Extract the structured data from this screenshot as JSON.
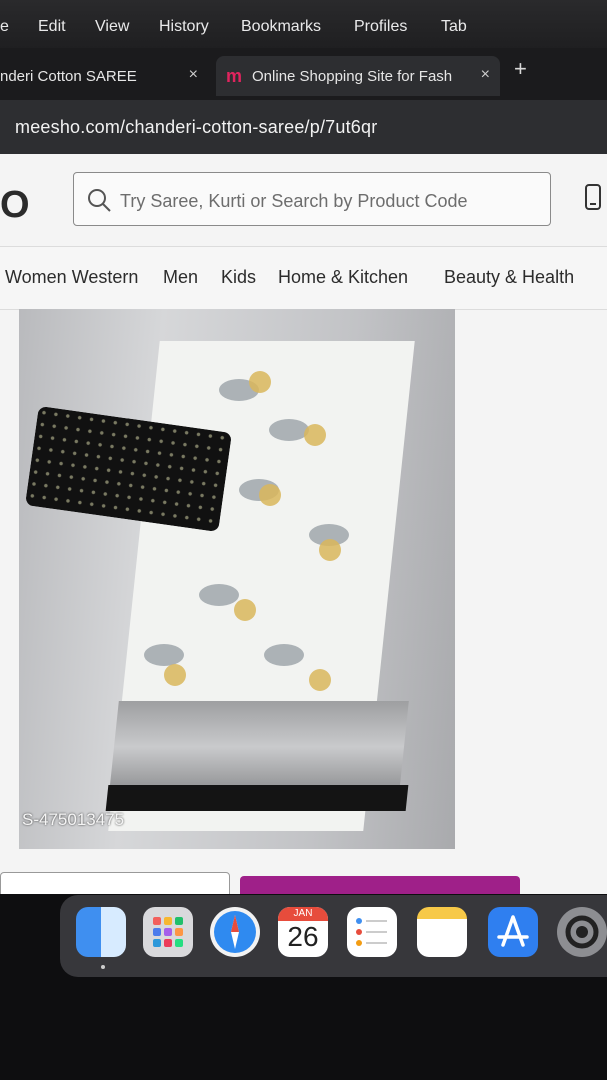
{
  "menubar": {
    "items": [
      "e",
      "Edit",
      "View",
      "History",
      "Bookmarks",
      "Profiles",
      "Tab"
    ]
  },
  "tabs": [
    {
      "label": "nderi Cotton SAREE",
      "close": "×",
      "active": false
    },
    {
      "label": "Online Shopping Site for Fash",
      "favicon": "m",
      "close": "×",
      "active": true
    }
  ],
  "new_tab": "+",
  "address": {
    "url": "meesho.com/chanderi-cotton-saree/p/7ut6qr"
  },
  "header": {
    "logo": "O",
    "search_placeholder": "Try Saree, Kurti or Search by Product Code",
    "search_icon": "search-icon",
    "device_icon": "mobile-phone-icon"
  },
  "categories": [
    "Women Western",
    "Men",
    "Kids",
    "Home & Kitchen",
    "Beauty & Health"
  ],
  "product": {
    "image_code": "S-475013475"
  },
  "dock": {
    "apps": [
      "finder-icon",
      "launchpad-icon",
      "safari-icon",
      "calendar-icon",
      "reminders-icon",
      "notes-icon",
      "app-store-icon",
      "system-preferences-icon"
    ],
    "calendar_month": "JAN",
    "calendar_day": "26"
  },
  "colors": {
    "buy_now": "#9f2089",
    "favicon": "#e0245e"
  }
}
